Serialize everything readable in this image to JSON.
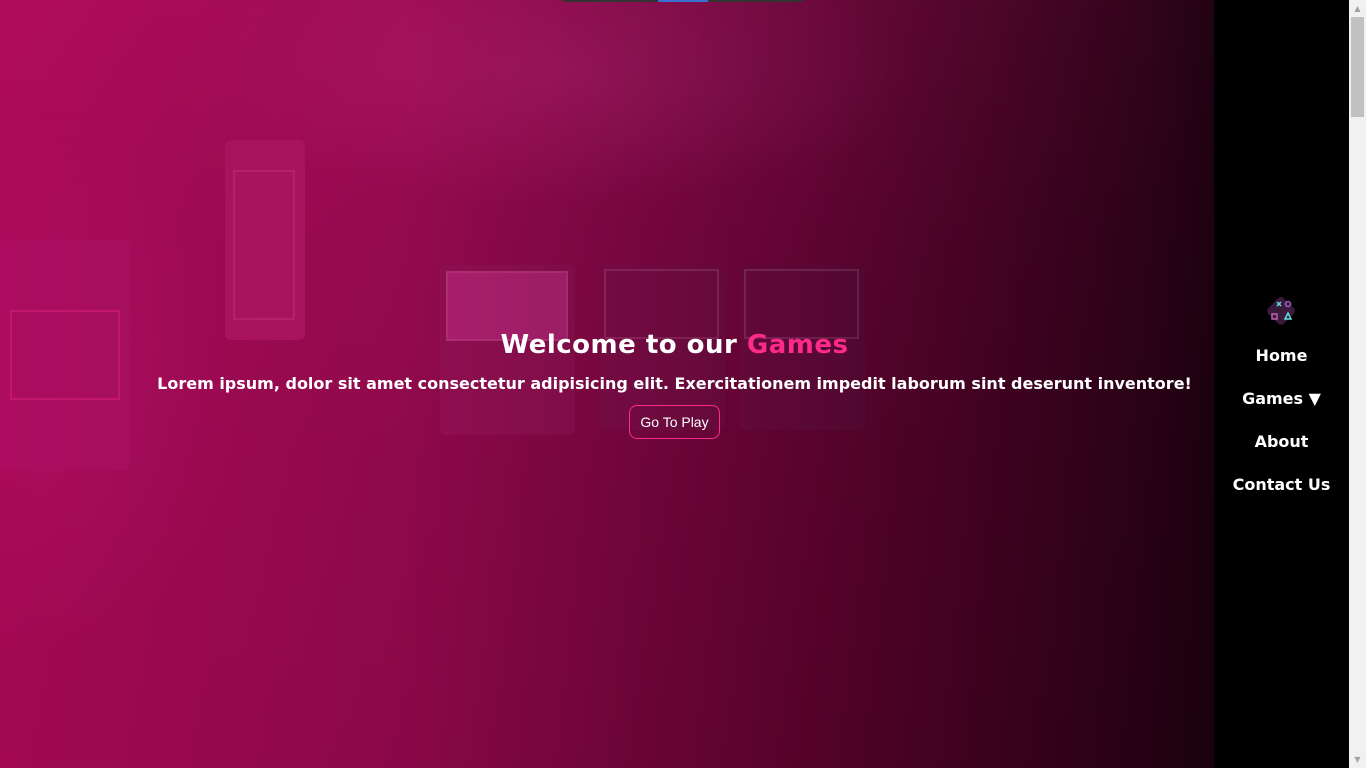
{
  "hero": {
    "title_prefix": "Welcome to our",
    "title_accent": "Games",
    "subtitle": "Lorem ipsum, dolor sit amet consectetur adipisicing elit. Exercitationem impedit laborum sint deserunt inventore!",
    "button_label": "Go To Play"
  },
  "sidebar": {
    "logo_icon": "gamepad-logo-icon",
    "items": [
      {
        "label": "Home"
      },
      {
        "label": "Games ▼"
      },
      {
        "label": "About"
      },
      {
        "label": "Contact Us"
      }
    ]
  },
  "colors": {
    "accent": "#ff2a8a",
    "overlay": "#c80a64",
    "sidebar": "#000000"
  }
}
